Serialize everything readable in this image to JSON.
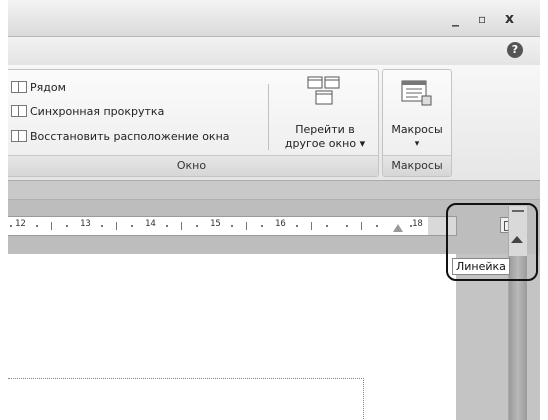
{
  "window": {
    "minimize_glyph": "_",
    "restore_glyph": "▫",
    "close_glyph": "x",
    "help_glyph": "?"
  },
  "ribbon": {
    "window_group": {
      "label": "Окно",
      "small_buttons": [
        {
          "label": "Рядом",
          "icon": "side-by-side-icon"
        },
        {
          "label": "Синхронная прокрутка",
          "icon": "synchronous-scrolling-icon"
        },
        {
          "label": "Восстановить расположение окна",
          "icon": "reset-window-position-icon"
        }
      ],
      "switch_windows": {
        "line1": "Перейти в",
        "line2": "другое окно ▾",
        "icon": "switch-windows-icon"
      }
    },
    "macros_group": {
      "label": "Макросы",
      "macros_button": {
        "line1": "Макросы",
        "line2": "▾",
        "icon": "macros-icon"
      }
    }
  },
  "ruler": {
    "numbers": [
      "12",
      "13",
      "14",
      "15",
      "16",
      "18"
    ],
    "view_ruler_icon": "view-ruler-icon"
  },
  "tooltip": {
    "text": "Линейка"
  }
}
